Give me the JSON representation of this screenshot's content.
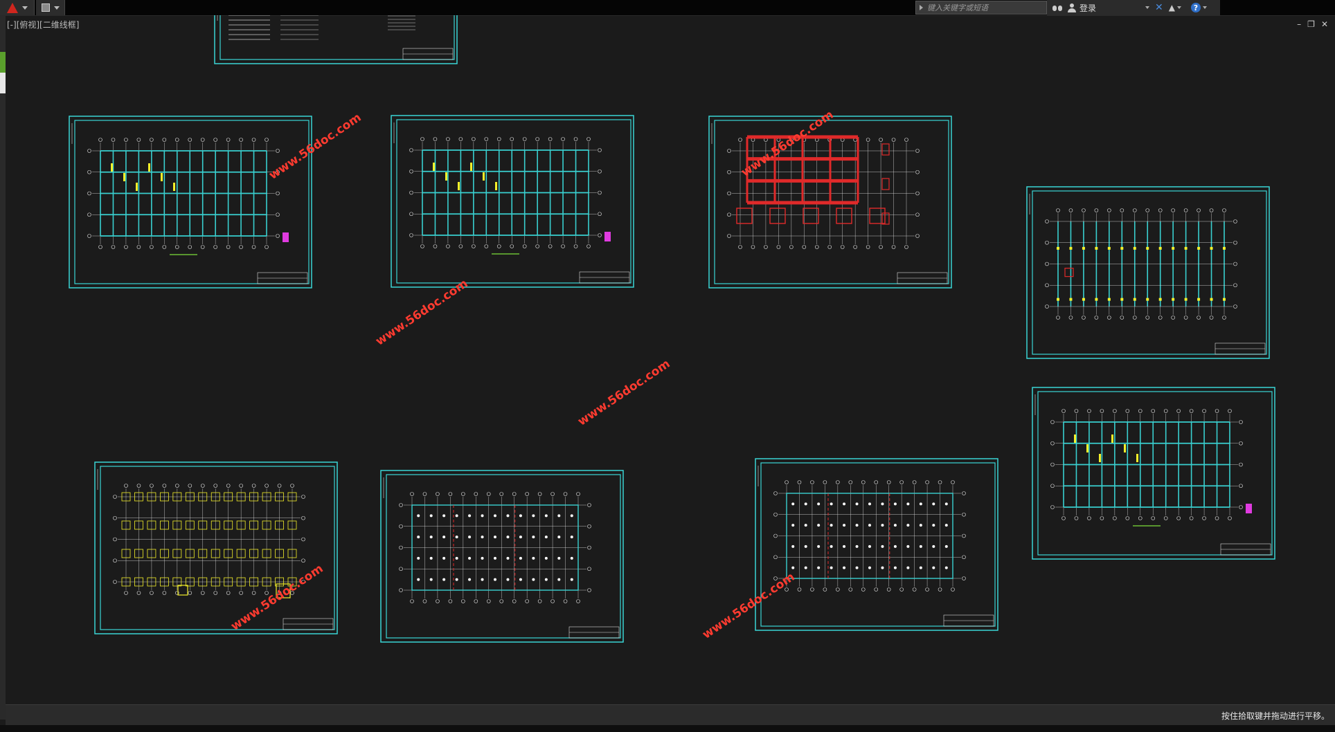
{
  "title_bar": {
    "search_placeholder": "键入关键字或短语",
    "login_label": "登录"
  },
  "viewport": {
    "label": "[-][俯视][二维线框]"
  },
  "watermark": {
    "text": "www.56doc.com"
  },
  "status_bar": {
    "message": "按住拾取键并拖动进行平移。"
  },
  "colors": {
    "background": "#1b1b1b",
    "sheet_border": "#3ad6d6",
    "watermark": "#ff3b30",
    "drawing_beam": "#39d0d0",
    "drawing_line": "#e8e8e8",
    "annotation_yellow": "#f4f02a",
    "annotation_magenta": "#e03be0",
    "rebar_red": "#e02a2a"
  },
  "icons": [
    "autocad-logo-icon",
    "save-icon",
    "binoculars-icon",
    "user-icon",
    "x-exchange-icon",
    "a360-icon",
    "help-icon",
    "minimize-icon",
    "restore-icon",
    "close-icon"
  ]
}
